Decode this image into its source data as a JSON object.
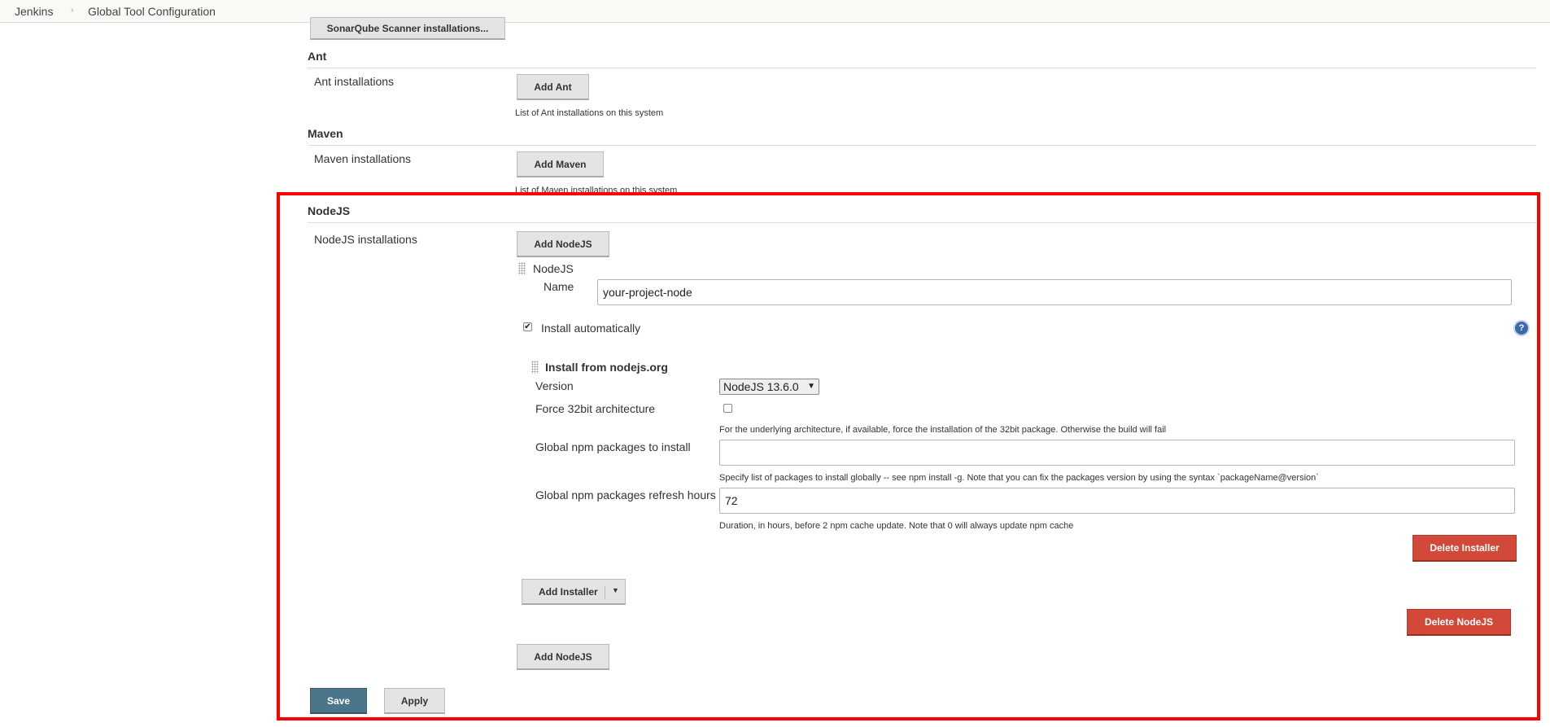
{
  "breadcrumb": {
    "items": [
      "Jenkins",
      "Global Tool Configuration"
    ],
    "separator": "›"
  },
  "sonarqube": {
    "button_label": "SonarQube Scanner installations..."
  },
  "ant": {
    "title": "Ant",
    "installations_label": "Ant installations",
    "add_button": "Add Ant",
    "description": "List of Ant installations on this system"
  },
  "maven": {
    "title": "Maven",
    "installations_label": "Maven installations",
    "add_button": "Add Maven",
    "description": "List of Maven installations on this system"
  },
  "nodejs": {
    "title": "NodeJS",
    "installations_label": "NodeJS installations",
    "add_button_top": "Add NodeJS",
    "item_header": "NodeJS",
    "name_label": "Name",
    "name_value": "your-project-node",
    "install_auto_label": "Install automatically",
    "install_auto_checked": true,
    "help_icon": "?",
    "installer": {
      "title": "Install from nodejs.org",
      "version_label": "Version",
      "version_value": "NodeJS 13.6.0",
      "force32_label": "Force 32bit architecture",
      "force32_checked": false,
      "force32_desc": "For the underlying architecture, if available, force the installation of the 32bit package. Otherwise the build will fail",
      "npm_packages_label": "Global npm packages to install",
      "npm_packages_value": "",
      "npm_packages_desc": "Specify list of packages to install globally -- see npm install -g. Note that you can fix the packages version by using the syntax `packageName@version`",
      "refresh_label": "Global npm packages refresh hours",
      "refresh_value": "72",
      "refresh_desc": "Duration, in hours, before 2 npm cache update. Note that 0 will always update npm cache",
      "delete_installer_button": "Delete Installer"
    },
    "add_installer_button": "Add Installer",
    "delete_nodejs_button": "Delete NodeJS",
    "add_button_bottom": "Add NodeJS"
  },
  "footer": {
    "save_label": "Save",
    "apply_label": "Apply"
  },
  "colors": {
    "highlight": "#ff0000",
    "danger": "#d24939",
    "primary": "#4b758b",
    "help": "#3a6aa8"
  }
}
